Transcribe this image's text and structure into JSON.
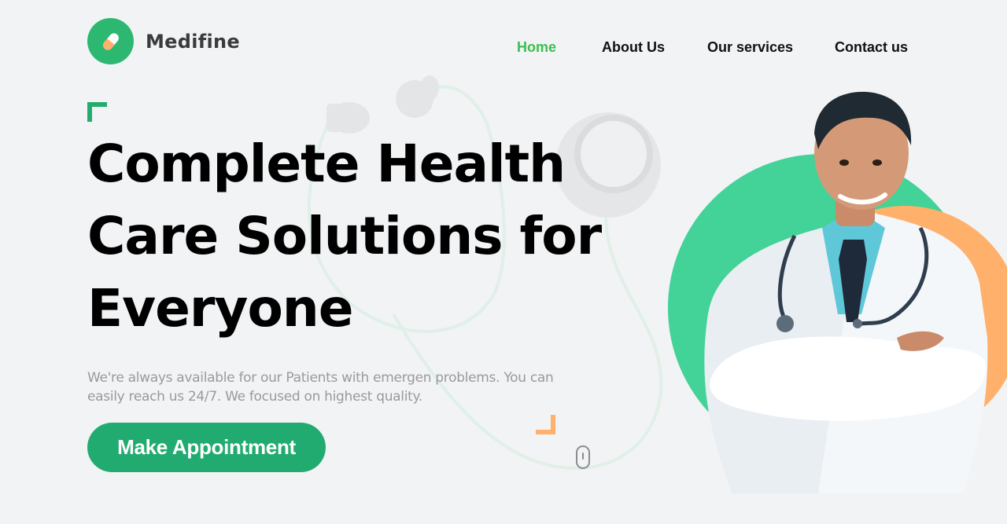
{
  "brand": {
    "name": "Medifine",
    "accent": "#2db872",
    "secondary": "#ffb06a",
    "logo_icon": "pill-icon"
  },
  "nav": {
    "items": [
      {
        "label": "Home",
        "active": true
      },
      {
        "label": "About Us",
        "active": false
      },
      {
        "label": "Our services",
        "active": false
      },
      {
        "label": "Contact us",
        "active": false
      }
    ],
    "active_color": "#3cbf4f"
  },
  "hero": {
    "title_lines": [
      "Complete Health",
      "Care Solutions for",
      "Everyone"
    ],
    "subtitle": "We're always available for our Patients with emergen problems. You can easily reach us 24/7. We focused on highest quality.",
    "cta_label": "Make Appointment",
    "cta_color": "#22ab70"
  },
  "decor": {
    "background_icon": "stethoscope-icon",
    "scroll_icon": "mouse-scroll-icon",
    "image_subject": "doctor-photo"
  }
}
